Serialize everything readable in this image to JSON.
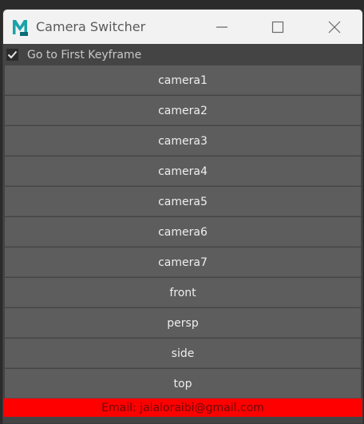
{
  "window": {
    "title": "Camera Switcher",
    "icon": "maya-icon"
  },
  "options": {
    "go_first_keyframe_label": "Go to First Keyframe",
    "go_first_keyframe_checked": true
  },
  "cameras": [
    {
      "label": "camera1"
    },
    {
      "label": "camera2"
    },
    {
      "label": "camera3"
    },
    {
      "label": "camera4"
    },
    {
      "label": "camera5"
    },
    {
      "label": "camera6"
    },
    {
      "label": "camera7"
    },
    {
      "label": "front"
    },
    {
      "label": "persp"
    },
    {
      "label": "side"
    },
    {
      "label": "top"
    }
  ],
  "footer": {
    "email_text": "Email: jalaloraibi@gmail.com"
  },
  "colors": {
    "footer_bg": "#ff0000",
    "button_bg": "#5d5d5d",
    "panel_bg": "#444444",
    "maya_teal": "#1aa3a8"
  }
}
